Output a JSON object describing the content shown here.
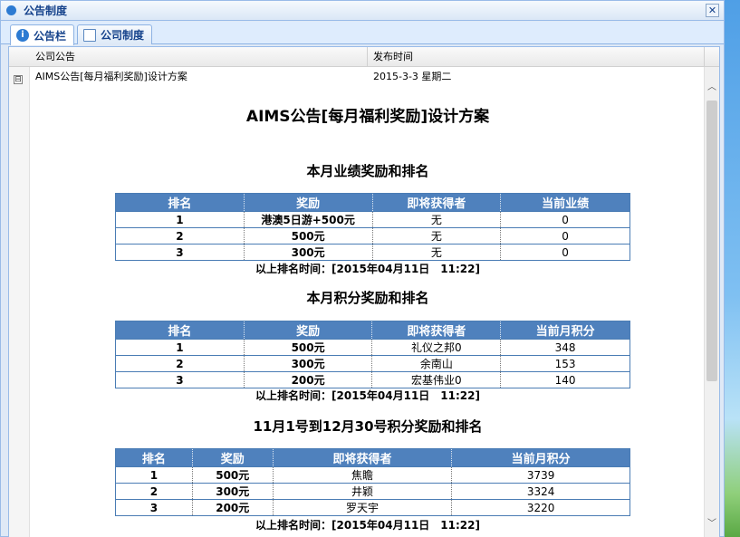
{
  "window": {
    "title": "公告制度",
    "close_glyph": "✕"
  },
  "tabs": [
    {
      "label": "公告栏",
      "active": true,
      "icon": "info-icon"
    },
    {
      "label": "公司制度",
      "active": false,
      "icon": "document-icon"
    }
  ],
  "grid": {
    "columns": [
      "公司公告",
      "发布时间"
    ],
    "row": {
      "expander": "⊟",
      "title": "AIMS公告[每月福利奖励]设计方案",
      "date": "2015-3-3 星期二"
    }
  },
  "article": {
    "title": "AIMS公告[每月福利奖励]设计方案",
    "sections": [
      {
        "heading": "本月业绩奖励和排名",
        "headers": [
          "排名",
          "奖励",
          "即将获得者",
          "当前业绩"
        ],
        "rows": [
          [
            "1",
            "港澳5日游+500元",
            "无",
            "0"
          ],
          [
            "2",
            "500元",
            "无",
            "0"
          ],
          [
            "3",
            "300元",
            "无",
            "0"
          ]
        ],
        "timestamp": "以上排名时间：[2015年04月11日　11:22]"
      },
      {
        "heading": "本月积分奖励和排名",
        "headers": [
          "排名",
          "奖励",
          "即将获得者",
          "当前月积分"
        ],
        "rows": [
          [
            "1",
            "500元",
            "礼仪之邦0",
            "348"
          ],
          [
            "2",
            "300元",
            "余南山",
            "153"
          ],
          [
            "3",
            "200元",
            "宏基伟业0",
            "140"
          ]
        ],
        "timestamp": "以上排名时间：[2015年04月11日　11:22]"
      },
      {
        "heading": "11月1号到12月30号积分奖励和排名",
        "headers": [
          "排名",
          "奖励",
          "即将获得者",
          "当前月积分"
        ],
        "rows": [
          [
            "1",
            "500元",
            "焦瞻",
            "3739"
          ],
          [
            "2",
            "300元",
            "井颖",
            "3324"
          ],
          [
            "3",
            "200元",
            "罗天宇",
            "3220"
          ]
        ],
        "timestamp": "以上排名时间：[2015年04月11日　11:22]"
      }
    ]
  },
  "scrollbar": {
    "up": "︿",
    "down": "﹀"
  },
  "colors": {
    "table_header": "#4f81bd",
    "title_text": "#15428b"
  }
}
